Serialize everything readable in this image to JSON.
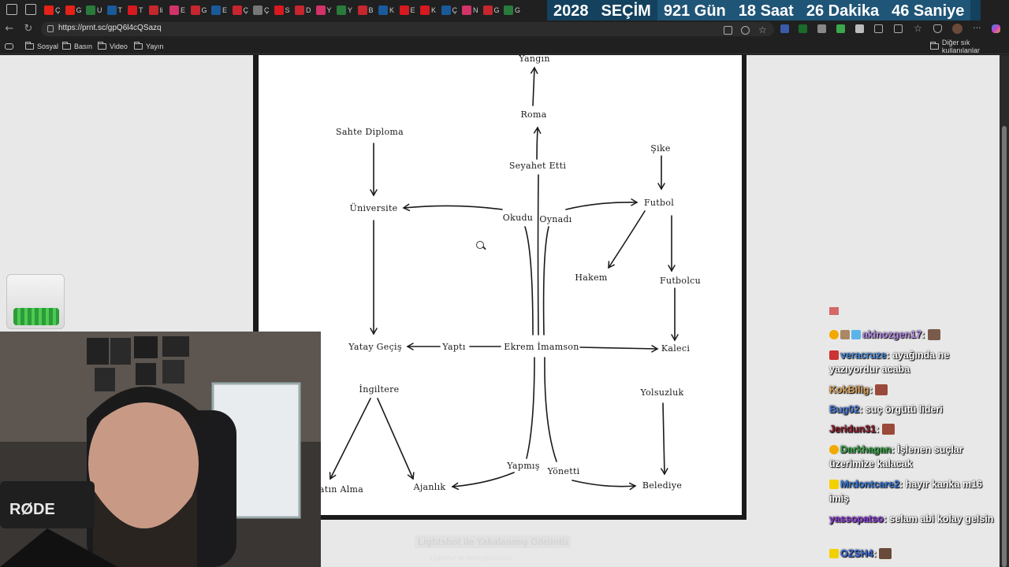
{
  "browser": {
    "tabs": [
      {
        "icon": "youtube-icon",
        "color": "#e62117",
        "label": "Ç"
      },
      {
        "icon": "youtube-icon",
        "color": "#e62117",
        "label": "G"
      },
      {
        "icon": "channel-icon",
        "color": "#2a7a3b",
        "label": "U"
      },
      {
        "icon": "news-icon",
        "color": "#1a5a9a",
        "label": "T"
      },
      {
        "icon": "twitter-icon",
        "color": "#d71920",
        "label": "T"
      },
      {
        "icon": "news-icon",
        "color": "#c6262e",
        "label": "li"
      },
      {
        "icon": "bluesky-icon",
        "color": "#d23369",
        "label": "E"
      },
      {
        "icon": "news-icon",
        "color": "#c6262e",
        "label": "G"
      },
      {
        "icon": "news-icon",
        "color": "#1a5a9a",
        "label": "E"
      },
      {
        "icon": "news-icon",
        "color": "#c6262e",
        "label": "Ç"
      },
      {
        "icon": "doc-icon",
        "color": "#777777",
        "label": "Ç"
      },
      {
        "icon": "news-icon",
        "color": "#d71920",
        "label": "S"
      },
      {
        "icon": "news-icon",
        "color": "#c6262e",
        "label": "D"
      },
      {
        "icon": "bluesky-icon",
        "color": "#d23369",
        "label": "Y"
      },
      {
        "icon": "channel-icon",
        "color": "#2a7a3b",
        "label": "Y"
      },
      {
        "icon": "news-icon",
        "color": "#c6262e",
        "label": "B"
      },
      {
        "icon": "news-icon",
        "color": "#1a5a9a",
        "label": "K"
      },
      {
        "icon": "news-icon",
        "color": "#d71920",
        "label": "E"
      },
      {
        "icon": "news-icon",
        "color": "#d71920",
        "label": "K"
      },
      {
        "icon": "news-icon",
        "color": "#1a5a9a",
        "label": "Ç"
      },
      {
        "icon": "bluesky-icon",
        "color": "#d23369",
        "label": "N"
      },
      {
        "icon": "news-icon",
        "color": "#c6262e",
        "label": "G"
      },
      {
        "icon": "channel-icon",
        "color": "#2a7a3b",
        "label": "G"
      }
    ],
    "countdown": {
      "year": "2028",
      "label": "SEÇİM",
      "days": "921 Gün",
      "hours": "18 Saat",
      "minutes": "26 Dakika",
      "seconds": "46 Saniye"
    },
    "url": "https://prnt.sc/gpQ6l4cQSazq",
    "bookmarks": [
      "Sosyal",
      "Basın",
      "Video",
      "Yayın"
    ],
    "other_bookmarks": "Diğer sık kullanılanlar"
  },
  "diagram": {
    "nodes": {
      "yangin": "Yangın",
      "roma": "Roma",
      "seyahet": "Seyahet Etti",
      "sahte": "Sahte Diploma",
      "sike": "Şike",
      "universite": "Üniversite",
      "okudu": "Okudu",
      "oynadi": "Oynadı",
      "futbol": "Futbol",
      "hakem": "Hakem",
      "futbolcu": "Futbolcu",
      "yatay": "Yatay Geçiş",
      "yapti": "Yaptı",
      "ekrem": "Ekrem İmamson",
      "kaleci": "Kaleci",
      "ingiltere": "İngiltere",
      "yolsuzluk": "Yolsuzluk",
      "satin": "atın Alma",
      "ajanlik": "Ajanlık",
      "yapmis": "Yapmış",
      "yonetti": "Yönetti",
      "belediye": "Belediye"
    }
  },
  "page": {
    "caption": "Lightshot ile Yakalanmış Görüntü",
    "caption_sub": "Lightshot ile ekran görüntüsü"
  },
  "chat": [
    {
      "user": "akinozgen17",
      "color": "#b48ce8",
      "text": "",
      "emote": true
    },
    {
      "user": "veracruze",
      "color": "#4a8ad8",
      "text": "ayağında ne yazıyordur acaba",
      "emote": false
    },
    {
      "user": "KokBilig",
      "color": "#d9a35a",
      "text": "",
      "emote": true
    },
    {
      "user": "Bug02",
      "color": "#4a7ad8",
      "text": "suç örgütü lideri",
      "emote": false
    },
    {
      "user": "Jeridun31",
      "color": "#8a1a2a",
      "text": "",
      "emote": true
    },
    {
      "user": "Darkhagan",
      "color": "#3aa84a",
      "text": "İşlenen suçlar üzerimize kalacak",
      "emote": false
    },
    {
      "user": "Mrdontcare2",
      "color": "#3a7ad8",
      "text": "hayır kanka m16 imiş",
      "emote": false
    },
    {
      "user": "yassopatso",
      "color": "#8a3ad8",
      "text": "selam abi kolay gelsin",
      "emote": false
    },
    {
      "user": "OZSH4",
      "color": "#3a6ad8",
      "text": "",
      "emote": true
    }
  ]
}
